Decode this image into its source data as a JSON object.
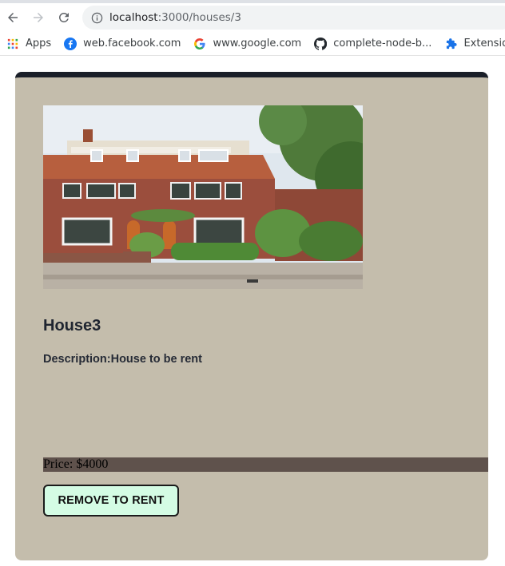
{
  "browser": {
    "url_host": "localhost",
    "url_rest": ":3000/houses/3",
    "bookmarks": [
      {
        "label": "Apps",
        "icon": "apps-grid-icon"
      },
      {
        "label": "web.facebook.com",
        "icon": "facebook-icon"
      },
      {
        "label": "www.google.com",
        "icon": "google-icon"
      },
      {
        "label": "complete-node-b...",
        "icon": "github-icon"
      },
      {
        "label": "Extensions",
        "icon": "puzzle-icon"
      }
    ]
  },
  "house": {
    "title": "House3",
    "description": "Description:House to be rent",
    "price": "Price: $4000",
    "button_label": "REMOVE TO RENT"
  },
  "colors": {
    "card_bg": "#c4bdac",
    "card_top_border": "#1a1f29",
    "price_bar": "#5f524c",
    "button_bg": "#d4fce4"
  }
}
